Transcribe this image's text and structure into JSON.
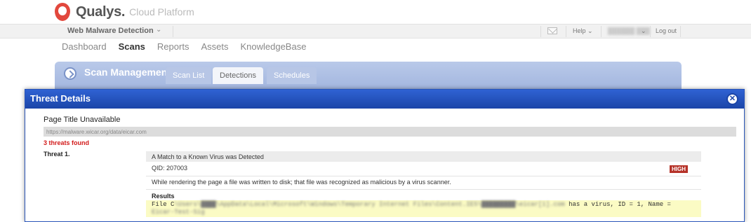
{
  "brand": {
    "name": "Qualys.",
    "product": "Cloud Platform"
  },
  "module_bar": {
    "module": "Web Malware Detection",
    "help": "Help",
    "user": "██████ ███",
    "logout": "Log out"
  },
  "nav": [
    "Dashboard",
    "Scans",
    "Reports",
    "Assets",
    "KnowledgeBase"
  ],
  "panel": {
    "title": "Scan Management",
    "tabs": [
      "Scan List",
      "Detections",
      "Schedules"
    ],
    "active_tab": "Detections"
  },
  "modal": {
    "title": "Threat Details",
    "page_title": "Page Title Unavailable",
    "url": "https://malware.wicar.org/data/eicar.com",
    "threats_found": "3 threats found",
    "threat_label": "Threat 1.",
    "threat_name": "A Match to a Known Virus was Detected",
    "qid": "QID: 207003",
    "severity": "HIGH",
    "description": "While rendering the page a file was written to disk; that file was recognized as malicious by a virus scanner.",
    "results_label": "Results",
    "results_prefix": "File C",
    "results_blurred": "\\Users\\████\\AppData\\Local\\Microsoft\\Windows\\Temporary Internet Files\\Content.IE5\\█████████\\eicar[1].com",
    "results_suffix": " has a virus, ID = 1, Name =",
    "results_line2_blurred": "Eicar-Test-Sig"
  },
  "colors": {
    "modal_header": "#2f62d3",
    "badge_high": "#b63228",
    "threat_count": "#d21a1a",
    "results_bg": "#fbfbc4"
  }
}
